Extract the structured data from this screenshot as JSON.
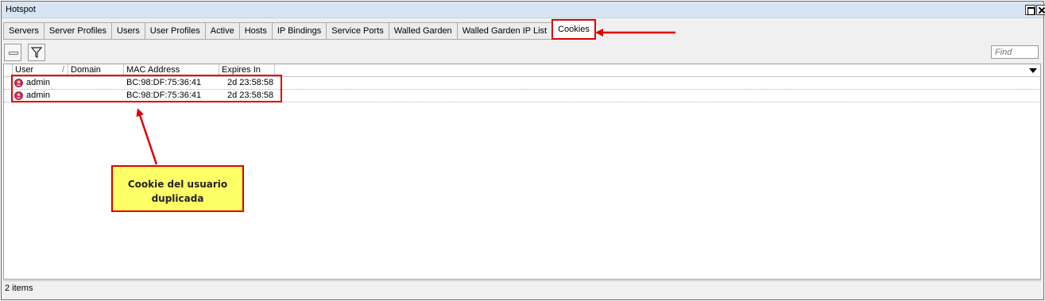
{
  "window": {
    "title": "Hotspot"
  },
  "tabs": [
    {
      "label": "Servers"
    },
    {
      "label": "Server Profiles"
    },
    {
      "label": "Users"
    },
    {
      "label": "User Profiles"
    },
    {
      "label": "Active"
    },
    {
      "label": "Hosts"
    },
    {
      "label": "IP Bindings"
    },
    {
      "label": "Service Ports"
    },
    {
      "label": "Walled Garden"
    },
    {
      "label": "Walled Garden IP List"
    },
    {
      "label": "Cookies",
      "active": true
    }
  ],
  "toolbar": {
    "remove_icon": "minus-icon",
    "filter_icon": "filter-icon",
    "find_placeholder": "Find"
  },
  "table": {
    "columns": [
      "User",
      "Domain",
      "MAC Address",
      "Expires In"
    ],
    "rows": [
      {
        "user": "admin",
        "domain": "",
        "mac": "BC:98:DF:75:36:41",
        "expires": "2d 23:58:58"
      },
      {
        "user": "admin",
        "domain": "",
        "mac": "BC:98:DF:75:36:41",
        "expires": "2d 23:58:58"
      }
    ]
  },
  "annotation": {
    "line1": "Cookie del usuario",
    "line2": "duplicada",
    "color": "#e00000",
    "fill": "#ffff66"
  },
  "status": {
    "items_text": "2 items"
  }
}
